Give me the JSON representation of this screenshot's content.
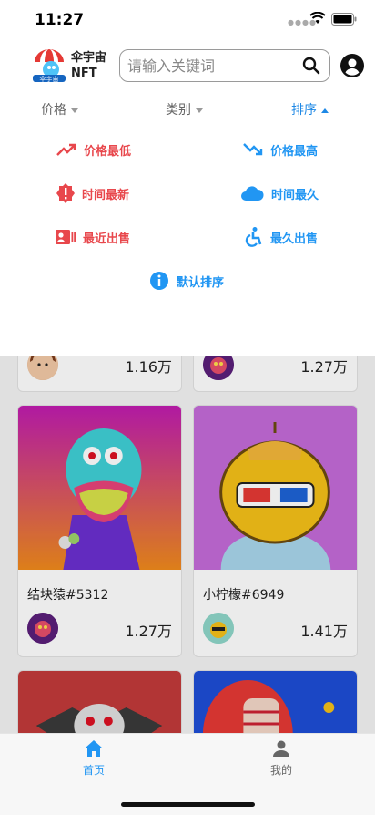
{
  "status_bar": {
    "time": "11:27"
  },
  "header": {
    "brand_line1": "伞宇宙",
    "brand_line2": "NFT",
    "search_placeholder": "请输入关键词"
  },
  "filters": [
    {
      "label": "价格",
      "active": false
    },
    {
      "label": "类别",
      "active": false
    },
    {
      "label": "排序",
      "active": true
    }
  ],
  "sort_options": [
    {
      "label": "价格最低",
      "icon": "trending-down-icon",
      "color": "#e8474c"
    },
    {
      "label": "价格最高",
      "icon": "trending-up-icon",
      "color": "#2196f3"
    },
    {
      "label": "时间最新",
      "icon": "alert-badge-icon",
      "color": "#e8474c"
    },
    {
      "label": "时间最久",
      "icon": "cloud-icon",
      "color": "#2196f3"
    },
    {
      "label": "最近出售",
      "icon": "id-card-icon",
      "color": "#e8474c"
    },
    {
      "label": "最久出售",
      "icon": "accessibility-icon",
      "color": "#2196f3"
    },
    {
      "label": "默认排序",
      "icon": "info-icon",
      "color": "#2196f3"
    }
  ],
  "cards": [
    {
      "name": "",
      "price": "1.16万"
    },
    {
      "name": "",
      "price": "1.27万"
    },
    {
      "name": "结块猿#5312",
      "price": "1.27万"
    },
    {
      "name": "小柠檬#6949",
      "price": "1.41万"
    },
    {
      "name": "",
      "price": ""
    },
    {
      "name": "",
      "price": ""
    }
  ],
  "tabbar": {
    "home_label": "首页",
    "mine_label": "我的"
  },
  "colors": {
    "accent": "#2196f3",
    "danger": "#e8474c"
  }
}
